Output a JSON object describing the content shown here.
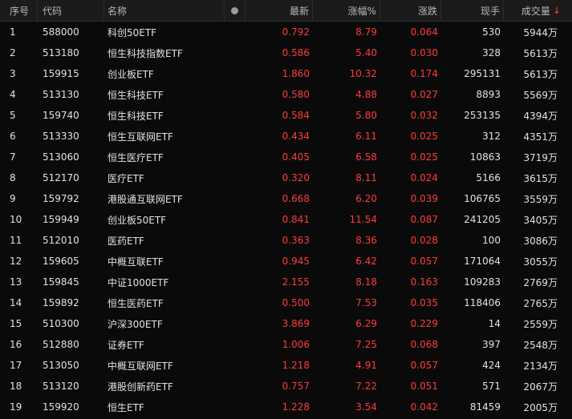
{
  "headers": {
    "idx": "序号",
    "code": "代码",
    "name": "名称",
    "price": "最新",
    "pct": "涨幅%",
    "chg": "涨跌",
    "vol": "现手",
    "amt": "成交量",
    "sort_arrow": "↓"
  },
  "colors": {
    "up": "#ff3b3b",
    "background": "#0a0a0a",
    "header_bg": "#1b1b1b"
  },
  "rows": [
    {
      "idx": "1",
      "code": "588000",
      "name": "科创50ETF",
      "price": "0.792",
      "pct": "8.79",
      "chg": "0.064",
      "vol": "530",
      "amt": "5944万"
    },
    {
      "idx": "2",
      "code": "513180",
      "name": "恒生科技指数ETF",
      "price": "0.586",
      "pct": "5.40",
      "chg": "0.030",
      "vol": "328",
      "amt": "5613万"
    },
    {
      "idx": "3",
      "code": "159915",
      "name": "创业板ETF",
      "price": "1.860",
      "pct": "10.32",
      "chg": "0.174",
      "vol": "295131",
      "amt": "5613万"
    },
    {
      "idx": "4",
      "code": "513130",
      "name": "恒生科技ETF",
      "price": "0.580",
      "pct": "4.88",
      "chg": "0.027",
      "vol": "8893",
      "amt": "5569万"
    },
    {
      "idx": "5",
      "code": "159740",
      "name": "恒生科技ETF",
      "price": "0.584",
      "pct": "5.80",
      "chg": "0.032",
      "vol": "253135",
      "amt": "4394万"
    },
    {
      "idx": "6",
      "code": "513330",
      "name": "恒生互联网ETF",
      "price": "0.434",
      "pct": "6.11",
      "chg": "0.025",
      "vol": "312",
      "amt": "4351万"
    },
    {
      "idx": "7",
      "code": "513060",
      "name": "恒生医疗ETF",
      "price": "0.405",
      "pct": "6.58",
      "chg": "0.025",
      "vol": "10863",
      "amt": "3719万"
    },
    {
      "idx": "8",
      "code": "512170",
      "name": "医疗ETF",
      "price": "0.320",
      "pct": "8.11",
      "chg": "0.024",
      "vol": "5166",
      "amt": "3615万"
    },
    {
      "idx": "9",
      "code": "159792",
      "name": "港股通互联网ETF",
      "price": "0.668",
      "pct": "6.20",
      "chg": "0.039",
      "vol": "106765",
      "amt": "3559万"
    },
    {
      "idx": "10",
      "code": "159949",
      "name": "创业板50ETF",
      "price": "0.841",
      "pct": "11.54",
      "chg": "0.087",
      "vol": "241205",
      "amt": "3405万"
    },
    {
      "idx": "11",
      "code": "512010",
      "name": "医药ETF",
      "price": "0.363",
      "pct": "8.36",
      "chg": "0.028",
      "vol": "100",
      "amt": "3086万"
    },
    {
      "idx": "12",
      "code": "159605",
      "name": "中概互联ETF",
      "price": "0.945",
      "pct": "6.42",
      "chg": "0.057",
      "vol": "171064",
      "amt": "3055万"
    },
    {
      "idx": "13",
      "code": "159845",
      "name": "中证1000ETF",
      "price": "2.155",
      "pct": "8.18",
      "chg": "0.163",
      "vol": "109283",
      "amt": "2769万"
    },
    {
      "idx": "14",
      "code": "159892",
      "name": "恒生医药ETF",
      "price": "0.500",
      "pct": "7.53",
      "chg": "0.035",
      "vol": "118406",
      "amt": "2765万"
    },
    {
      "idx": "15",
      "code": "510300",
      "name": "沪深300ETF",
      "price": "3.869",
      "pct": "6.29",
      "chg": "0.229",
      "vol": "14",
      "amt": "2559万"
    },
    {
      "idx": "16",
      "code": "512880",
      "name": "证券ETF",
      "price": "1.006",
      "pct": "7.25",
      "chg": "0.068",
      "vol": "397",
      "amt": "2548万"
    },
    {
      "idx": "17",
      "code": "513050",
      "name": "中概互联网ETF",
      "price": "1.218",
      "pct": "4.91",
      "chg": "0.057",
      "vol": "424",
      "amt": "2134万"
    },
    {
      "idx": "18",
      "code": "513120",
      "name": "港股创新药ETF",
      "price": "0.757",
      "pct": "7.22",
      "chg": "0.051",
      "vol": "571",
      "amt": "2067万"
    },
    {
      "idx": "19",
      "code": "159920",
      "name": "恒生ETF",
      "price": "1.228",
      "pct": "3.54",
      "chg": "0.042",
      "vol": "81459",
      "amt": "2005万"
    }
  ]
}
